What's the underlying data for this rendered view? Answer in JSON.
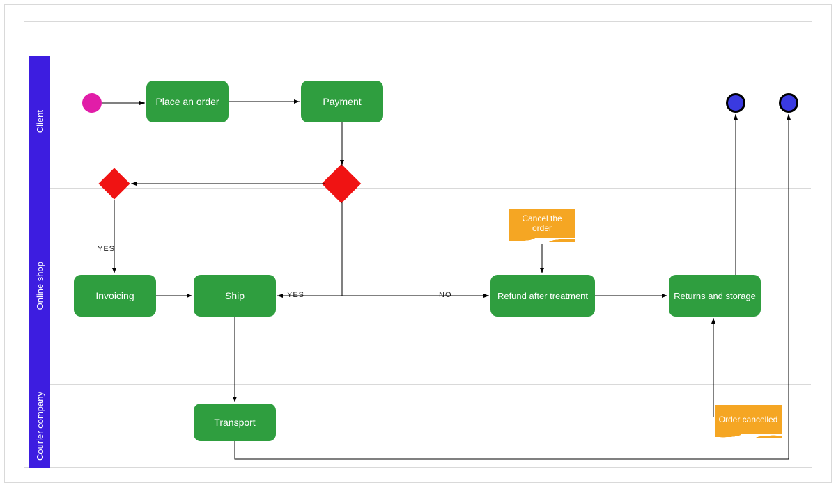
{
  "lanes": {
    "client": "Client",
    "shop": "Online shop",
    "courier": "Courier company"
  },
  "nodes": {
    "place_order": "Place an order",
    "payment": "Payment",
    "invoicing": "Invoicing",
    "ship": "Ship",
    "refund": "Refund after treatment",
    "returns": "Returns and storage",
    "transport": "Transport"
  },
  "notes": {
    "cancel": "Cancel the order",
    "order_cancelled": "Order cancelled"
  },
  "edge_labels": {
    "yes_invoicing": "YES",
    "yes_ship": "YES",
    "no_refund": "NO"
  },
  "colors": {
    "lane_header": "#3d1de0",
    "process": "#2f9e3f",
    "start": "#e11da8",
    "end": "#3a3ae0",
    "decision": "#f01313",
    "note": "#f5a623"
  }
}
